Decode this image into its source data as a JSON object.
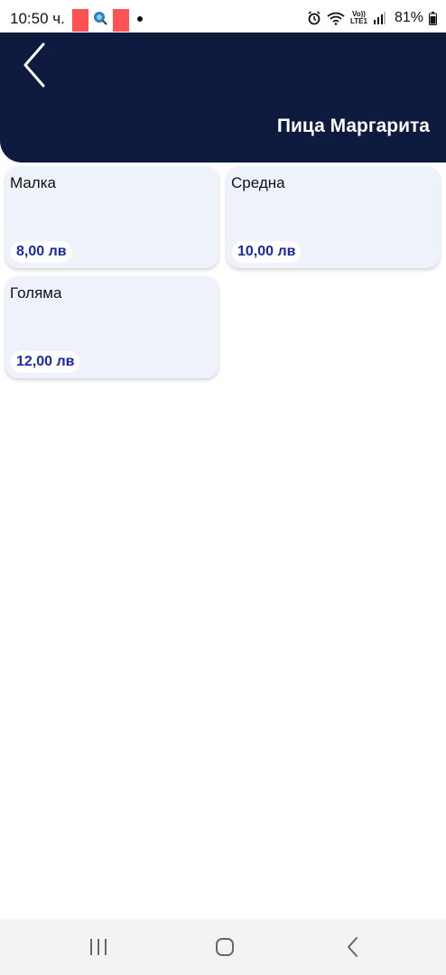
{
  "status_bar": {
    "time": "10:50 ч.",
    "lte_label_top": "Vo))",
    "lte_label_bottom": "LTE1",
    "network_type": "6",
    "battery": "81%"
  },
  "header": {
    "title": "Пица Маргарита"
  },
  "sizes": [
    {
      "name": "Малка",
      "price": "8,00 лв"
    },
    {
      "name": "Средна",
      "price": "10,00 лв"
    },
    {
      "name": "Голяма",
      "price": "12,00 лв"
    }
  ],
  "colors": {
    "header_bg": "#0f1a3f",
    "card_bg": "#eef2fb",
    "price_text": "#1a2aa0"
  },
  "icons": {
    "back": "back-arrow-icon",
    "nav_recents": "recents-icon",
    "nav_home": "home-icon",
    "nav_back": "nav-back-icon"
  }
}
